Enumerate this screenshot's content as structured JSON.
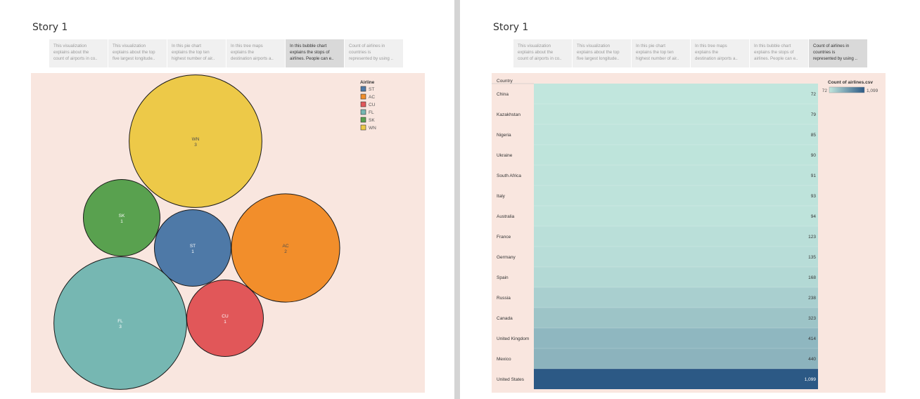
{
  "left": {
    "story_title": "Story 1",
    "captions": [
      {
        "lines": [
          "This visualization",
          "explains about the",
          "count of airports in co.."
        ],
        "selected": false
      },
      {
        "lines": [
          "This visualization",
          "explains about the top",
          "five largest longitude.."
        ],
        "selected": false
      },
      {
        "lines": [
          "In this pie chart",
          "explains the top ten",
          "highest number of air.."
        ],
        "selected": false
      },
      {
        "lines": [
          "In this tree maps",
          "explains the",
          "destination airports a.."
        ],
        "selected": false
      },
      {
        "lines": [
          "In this bubble chart",
          "explains the stops of",
          "airlines. People can e.."
        ],
        "selected": true
      },
      {
        "lines": [
          "Count of airlines in",
          "countries is",
          "represented by using .."
        ],
        "selected": false
      }
    ]
  },
  "right": {
    "story_title": "Story 1",
    "captions": [
      {
        "lines": [
          "This visualization",
          "explains about the",
          "count of airports in co.."
        ],
        "selected": false
      },
      {
        "lines": [
          "This visualization",
          "explains about the top",
          "five largest longitude.."
        ],
        "selected": false
      },
      {
        "lines": [
          "In this pie chart",
          "explains the top ten",
          "highest number of air.."
        ],
        "selected": false
      },
      {
        "lines": [
          "In this tree maps",
          "explains the",
          "destination airports a.."
        ],
        "selected": false
      },
      {
        "lines": [
          "In this bubble chart",
          "explains the stops of",
          "airlines. People can e.."
        ],
        "selected": false
      },
      {
        "lines": [
          "Count of airlines in",
          "countries is",
          "represented by using .."
        ],
        "selected": true
      }
    ]
  },
  "chart_data": [
    {
      "type": "bubble",
      "legend_title": "Airline",
      "legend_position": "top-right",
      "categories": [
        "ST",
        "AC",
        "CU",
        "FL",
        "SK",
        "WN"
      ],
      "values": [
        1,
        2,
        1,
        3,
        1,
        3
      ],
      "colors": {
        "ST": "#4e79a7",
        "AC": "#f28e2b",
        "CU": "#e15759",
        "FL": "#76b7b2",
        "SK": "#59a14f",
        "WN": "#edc948"
      }
    },
    {
      "type": "heatmap",
      "row_header": "Country",
      "legend_title": "Count of airlines.csv",
      "legend_position": "top-right",
      "color_range": [
        72,
        1099
      ],
      "color_range_labels": [
        "72",
        "1,099"
      ],
      "colors": {
        "low": "#c1e6dd",
        "high": "#2c5985"
      },
      "categories": [
        "China",
        "Kazakhstan",
        "Nigeria",
        "Ukraine",
        "South Africa",
        "Italy",
        "Australia",
        "France",
        "Germany",
        "Spain",
        "Russia",
        "Canada",
        "United Kingdom",
        "Mexico",
        "United States"
      ],
      "values": [
        72,
        79,
        85,
        90,
        91,
        93,
        94,
        123,
        135,
        168,
        238,
        323,
        414,
        440,
        1099
      ],
      "value_labels": [
        "72",
        "79",
        "85",
        "90",
        "91",
        "93",
        "94",
        "123",
        "135",
        "168",
        "238",
        "323",
        "414",
        "440",
        "1,099"
      ]
    }
  ]
}
